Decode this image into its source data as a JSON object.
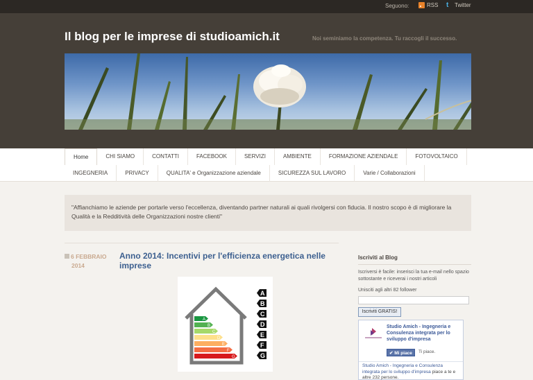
{
  "topbar": {
    "follow_label": "Seguono:",
    "rss_label": "RSS",
    "twitter_label": "Twitter"
  },
  "header": {
    "site_title": "Il blog per le imprese di studioamich.it",
    "tagline": "Noi seminiamo la competenza. Tu raccogli il successo."
  },
  "nav": {
    "row1": [
      "Home",
      "CHI SIAMO",
      "CONTATTI",
      "FACEBOOK",
      "SERVIZI",
      "AMBIENTE",
      "FORMAZIONE AZIENDALE",
      "FOTOVOLTAICO"
    ],
    "row2": [
      "INGEGNERIA",
      "PRIVACY",
      "QUALITA' e Organizzazione aziendale",
      "SICUREZZA SUL LAVORO",
      "Varie / Collaborazioni"
    ]
  },
  "quote": "\"Affianchiamo le aziende per portarle verso l'eccellenza, diventando partner naturali ai quali rivolgersi con fiducia. Il nostro scopo è di migliorare la Qualità e la Redditività delle Organizzazioni nostre clienti\"",
  "post": {
    "date_day": "6 FEBBRAIO",
    "date_year": "2014",
    "title": "Anno 2014: Incentivi per l'efficienza energetica nelle imprese",
    "energy_classes": [
      "A",
      "B",
      "C",
      "D",
      "E",
      "F",
      "G"
    ],
    "class_colors": [
      "#1a9641",
      "#52b151",
      "#a6d96a",
      "#fee08b",
      "#fdae61",
      "#f46d43",
      "#d7191c"
    ]
  },
  "sidebar": {
    "title": "Iscriviti al Blog",
    "text": "Iscriversi è facile: inserisci la tua e-mail nello spazio sottostante e riceverai i nostri articoli",
    "followers": "Unisciti agli altri 82 follower",
    "subscribe_button": "Iscriviti GRATIS!",
    "facebook": {
      "page_name": "Studio Amich - Ingegneria e Consulenza integrata per lo sviluppo d'impresa",
      "like_button": "Mi piace",
      "like_text": "Ti piace.",
      "desc_name": "Studio Amich - Ingegneria e Consulenza integrata per lo sviluppo d'impresa",
      "desc_rest": " piace a te e altre 232 persone."
    }
  },
  "colors": {
    "header_bg": "#453f38",
    "topbar_bg": "#2c2824",
    "title_link": "#3c5f8f",
    "date": "#c9a98f"
  }
}
